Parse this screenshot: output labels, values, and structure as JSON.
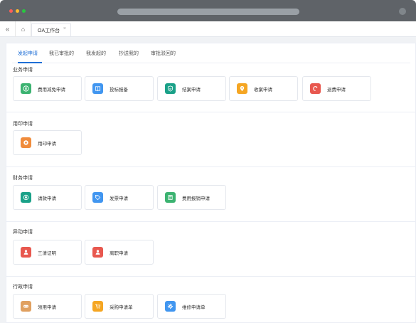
{
  "window": {
    "tab_label": "OA工作台",
    "close_glyph": "×"
  },
  "nav": {
    "back_glyph": "«",
    "home_glyph": "⌂"
  },
  "tabs": [
    {
      "label": "发起申请",
      "active": true
    },
    {
      "label": "我已审批的",
      "active": false
    },
    {
      "label": "我发起的",
      "active": false
    },
    {
      "label": "抄送我的",
      "active": false
    },
    {
      "label": "审批驳回的",
      "active": false
    }
  ],
  "colors": {
    "accent": "#1f6fd6",
    "green": "#3cb371",
    "blue": "#4196f0",
    "teal": "#1aa188",
    "amber": "#f5a623",
    "red": "#e8584f",
    "orange": "#f08c3c",
    "tan": "#e0a060"
  },
  "sections": [
    {
      "title": "业务申请",
      "items": [
        {
          "label": "费用减免申请",
          "icon": "yuan-coin-icon",
          "color": "#3cb371"
        },
        {
          "label": "投标报备",
          "icon": "book-icon",
          "color": "#4196f0"
        },
        {
          "label": "结案申请",
          "icon": "shield-check-icon",
          "color": "#1aa188"
        },
        {
          "label": "收案申请",
          "icon": "location-pin-icon",
          "color": "#f5a623"
        },
        {
          "label": "退费申请",
          "icon": "refresh-icon",
          "color": "#e8584f"
        }
      ]
    },
    {
      "title": "用印申请",
      "items": [
        {
          "label": "用印申请",
          "icon": "seal-stamp-icon",
          "color": "#f08c3c"
        }
      ]
    },
    {
      "title": "财务申请",
      "items": [
        {
          "label": "请款申请",
          "icon": "target-icon",
          "color": "#1aa188"
        },
        {
          "label": "发票申请",
          "icon": "tag-icon",
          "color": "#4196f0"
        },
        {
          "label": "费用报销申请",
          "icon": "calculator-icon",
          "color": "#3cb371"
        }
      ]
    },
    {
      "title": "异动申请",
      "items": [
        {
          "label": "三清证明",
          "icon": "person-icon",
          "color": "#e8584f"
        },
        {
          "label": "离职申请",
          "icon": "person-leave-icon",
          "color": "#e8584f"
        }
      ]
    },
    {
      "title": "行政申请",
      "items": [
        {
          "label": "领用申请",
          "icon": "gamepad-icon",
          "color": "#e0a060"
        },
        {
          "label": "采购申请单",
          "icon": "shopping-cart-icon",
          "color": "#f5a623"
        },
        {
          "label": "维修申请单",
          "icon": "gear-icon",
          "color": "#4196f0"
        }
      ]
    }
  ]
}
